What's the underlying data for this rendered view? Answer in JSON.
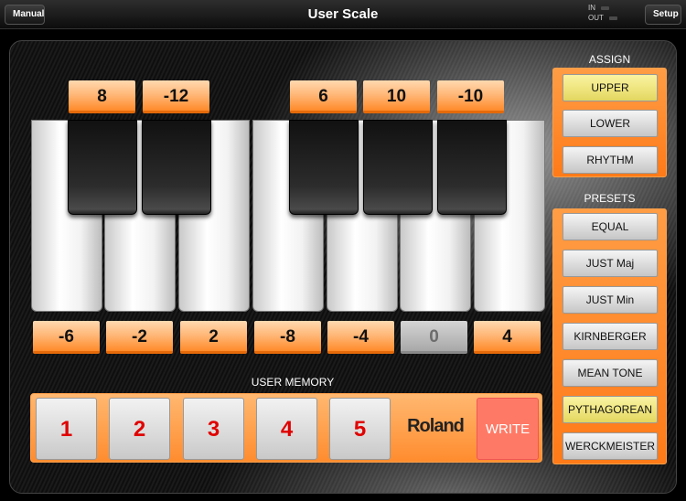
{
  "topbar": {
    "manual_label": "Manual",
    "title": "User Scale",
    "in_label": "IN",
    "out_label": "OUT",
    "setup_label": "Setup"
  },
  "black_values": [
    "8",
    "-12",
    "6",
    "10",
    "-10"
  ],
  "white_values": [
    {
      "value": "-6",
      "state": "active"
    },
    {
      "value": "-2",
      "state": "active"
    },
    {
      "value": "2",
      "state": "active"
    },
    {
      "value": "-8",
      "state": "active"
    },
    {
      "value": "-4",
      "state": "active"
    },
    {
      "value": "0",
      "state": "neutral"
    },
    {
      "value": "4",
      "state": "active"
    }
  ],
  "user_memory": {
    "label": "USER MEMORY",
    "slots": [
      "1",
      "2",
      "3",
      "4",
      "5"
    ],
    "brand": "Roland",
    "write_label": "WRITE"
  },
  "assign": {
    "label": "ASSIGN",
    "items": [
      {
        "label": "UPPER",
        "active": true
      },
      {
        "label": "LOWER",
        "active": false
      },
      {
        "label": "RHYTHM",
        "active": false
      }
    ]
  },
  "presets": {
    "label": "PRESETS",
    "items": [
      {
        "label": "EQUAL",
        "active": false
      },
      {
        "label": "JUST Maj",
        "active": false
      },
      {
        "label": "JUST Min",
        "active": false
      },
      {
        "label": "KIRNBERGER",
        "active": false
      },
      {
        "label": "MEAN TONE",
        "active": false
      },
      {
        "label": "PYTHAGOREAN",
        "active": true
      },
      {
        "label": "WERCKMEISTER",
        "active": false
      }
    ]
  },
  "colors": {
    "accent_orange": "#ff8a2a",
    "active_yellow": "#e3d760",
    "memory_number_red": "#e00000",
    "write_red": "#ff7a66"
  }
}
